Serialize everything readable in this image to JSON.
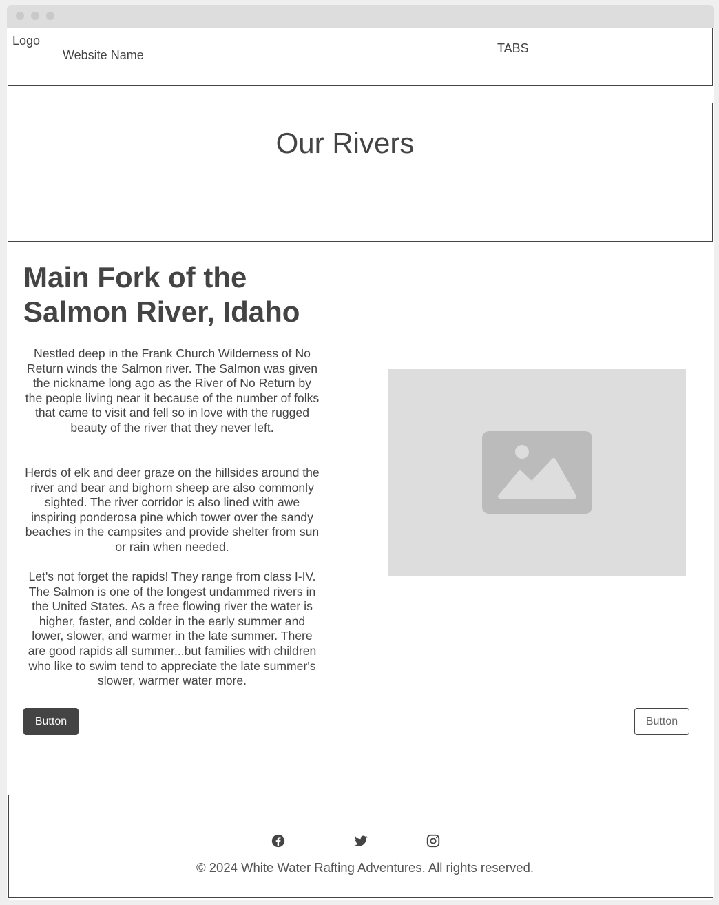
{
  "header": {
    "logo": "Logo",
    "site_name": "Website Name",
    "tabs": "TABS"
  },
  "hero": {
    "title": "Our Rivers"
  },
  "river": {
    "title": "Main Fork of the Salmon River, Idaho",
    "paragraphs": [
      "Nestled deep in the Frank Church Wilderness of No Return winds the Salmon river. The Salmon was given the nickname long ago as the River of No Return by the people living near it because of the number of folks that came to visit and fell so in love with the rugged beauty of the river that they never left.",
      "Herds of elk and deer graze on the hillsides around the river and bear and bighorn sheep are also commonly sighted. The river corridor is also lined with awe inspiring ponderosa pine which tower over the sandy beaches in the campsites and provide shelter from sun or rain when needed.",
      "Let's not forget the rapids! They range from class I-IV. The Salmon is one of the longest undammed rivers in the United States. As a free flowing river the water is higher, faster, and colder in the early summer and lower, slower, and warmer in the late summer. There are good rapids all summer...but families with children who like to swim tend to appreciate the late summer's slower, warmer water more."
    ],
    "image_icon": "image-placeholder-icon"
  },
  "actions": {
    "primary_label": "Button",
    "secondary_label": "Button"
  },
  "footer": {
    "social": [
      "facebook-icon",
      "twitter-icon",
      "instagram-icon"
    ],
    "copyright": "© 2024 White Water Rafting Adventures. All rights reserved."
  },
  "colors": {
    "page_background": "#efefef",
    "text": "#444444",
    "placeholder": "#dddddd",
    "placeholder_icon": "#bbbbbb",
    "primary_button": "#444444"
  }
}
